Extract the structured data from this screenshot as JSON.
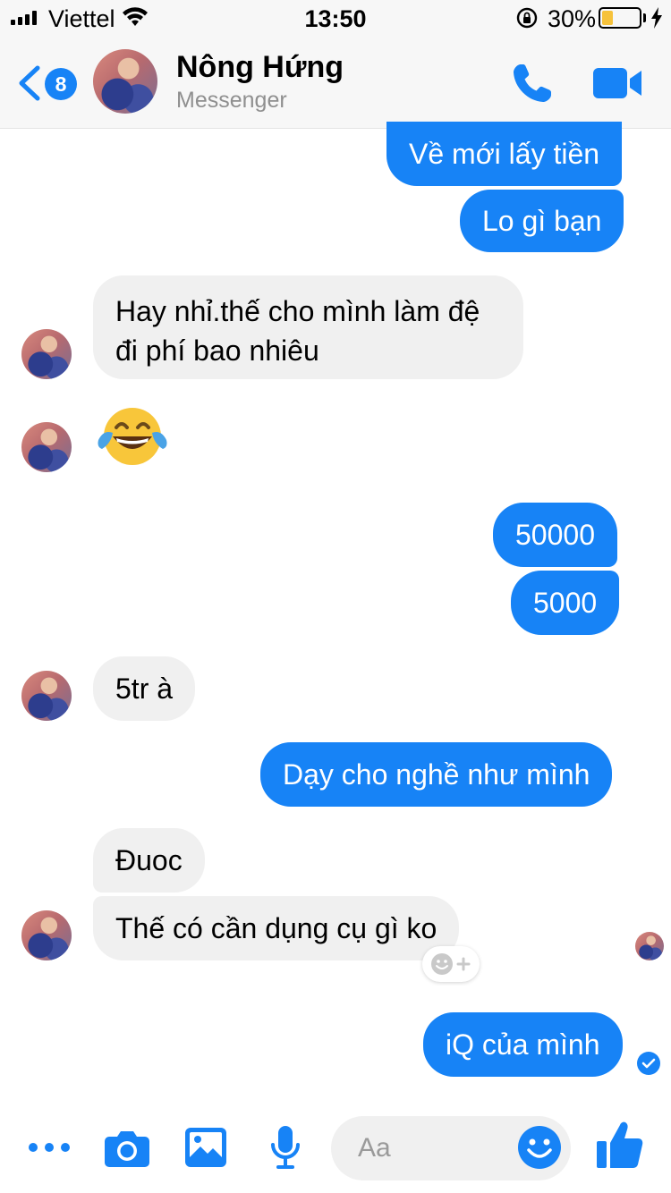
{
  "status_bar": {
    "carrier": "Viettel",
    "time": "13:50",
    "battery_percent": "30%",
    "battery_level": 0.3
  },
  "header": {
    "unread_count": "8",
    "contact_name": "Nông Hứng",
    "subtitle": "Messenger"
  },
  "messages": [
    {
      "from": "me",
      "text": "Về mới lấy tiền"
    },
    {
      "from": "me",
      "text": "Lo gì bạn"
    },
    {
      "from": "them",
      "text": "Hay nhỉ.thế cho mình làm đệ đi phí bao nhiêu"
    },
    {
      "from": "them",
      "text": "😂"
    },
    {
      "from": "me",
      "text": "50000"
    },
    {
      "from": "me",
      "text": "5000"
    },
    {
      "from": "them",
      "text": "5tr à"
    },
    {
      "from": "me",
      "text": "Dạy cho nghề như mình"
    },
    {
      "from": "them",
      "text": "Đuoc"
    },
    {
      "from": "them",
      "text": "Thế có cần dụng cụ gì ko"
    },
    {
      "from": "me",
      "text": "iQ của mình"
    }
  ],
  "composer": {
    "placeholder": "Aa"
  },
  "colors": {
    "accent": "#1783f6",
    "incoming_bubble": "#f0f0f0",
    "battery_fill": "#f6c23b"
  }
}
